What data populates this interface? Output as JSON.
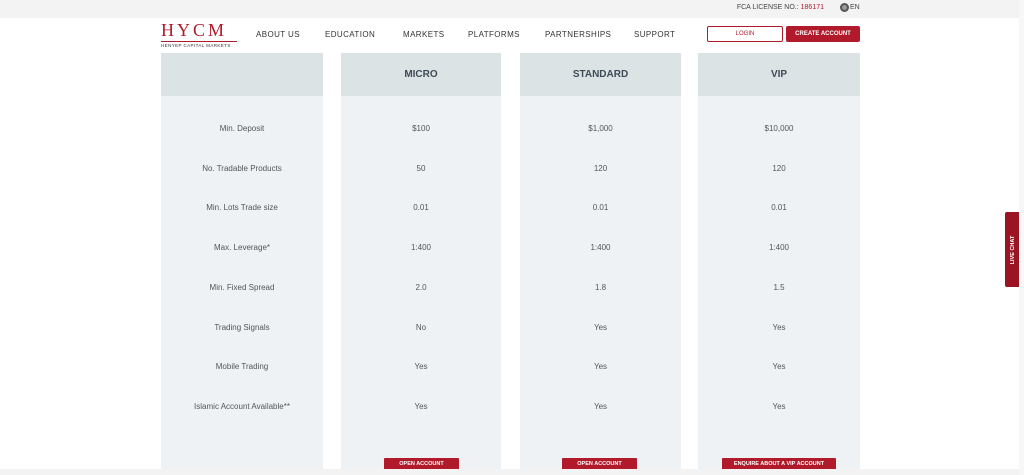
{
  "topbar": {
    "fca_label": "FCA LICENSE NO.:",
    "fca_number": "186171",
    "language": "EN"
  },
  "brand": {
    "name": "HYCM",
    "tagline": "HENYEP CAPITAL MARKETS"
  },
  "nav": [
    "ABOUT US",
    "EDUCATION",
    "MARKETS",
    "PLATFORMS",
    "PARTNERSHIPS",
    "SUPPORT"
  ],
  "header_buttons": {
    "login": "LOGIN",
    "create": "CREATE ACCOUNT"
  },
  "table": {
    "columns": [
      "MICRO",
      "STANDARD",
      "VIP"
    ],
    "rows": [
      {
        "label": "Min. Deposit",
        "values": [
          "$100",
          "$1,000",
          "$10,000"
        ]
      },
      {
        "label": "No. Tradable Products",
        "values": [
          "50",
          "120",
          "120"
        ]
      },
      {
        "label": "Min. Lots Trade size",
        "values": [
          "0.01",
          "0.01",
          "0.01"
        ]
      },
      {
        "label": "Max. Leverage*",
        "values": [
          "1:400",
          "1:400",
          "1:400"
        ]
      },
      {
        "label": "Min. Fixed Spread",
        "values": [
          "2.0",
          "1.8",
          "1.5"
        ]
      },
      {
        "label": "Trading Signals",
        "values": [
          "No",
          "Yes",
          "Yes"
        ]
      },
      {
        "label": "Mobile Trading",
        "values": [
          "Yes",
          "Yes",
          "Yes"
        ]
      },
      {
        "label": "Islamic Account Available**",
        "values": [
          "Yes",
          "Yes",
          "Yes"
        ]
      }
    ],
    "cta": [
      "OPEN ACCOUNT",
      "OPEN ACCOUNT",
      "ENQUIRE ABOUT A VIP ACCOUNT"
    ]
  },
  "live_chat": "LIVE CHAT",
  "colors": {
    "accent": "#b11a2a",
    "column_bg": "#eef2f4",
    "column_header_bg": "#dbe3e5"
  }
}
